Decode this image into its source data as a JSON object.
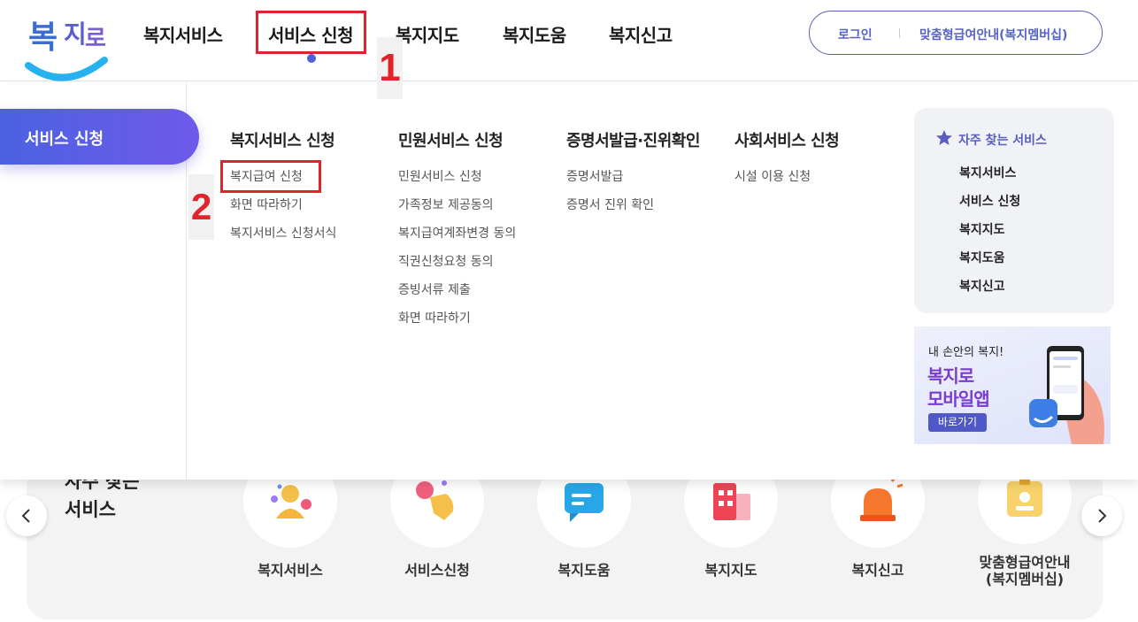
{
  "header": {
    "nav": [
      "복지서비스",
      "서비스 신청",
      "복지지도",
      "복지도움",
      "복지신고"
    ],
    "login": "로그인",
    "custom_benefit": "맞춤형급여안내(복지멤버십)"
  },
  "markers": {
    "one": "1",
    "two": "2"
  },
  "menu": {
    "active": "서비스 신청",
    "columns": [
      {
        "title": "복지서비스 신청",
        "items": [
          "복지급여 신청",
          "화면 따라하기",
          "복지서비스 신청서식"
        ]
      },
      {
        "title": "민원서비스 신청",
        "items": [
          "민원서비스 신청",
          "가족정보 제공동의",
          "복지급여계좌변경 동의",
          "직권신청요청 동의",
          "증빙서류 제출",
          "화면 따라하기"
        ]
      },
      {
        "title": "증명서발급·진위확인",
        "items": [
          "증명서발급",
          "증명서 진위 확인"
        ]
      },
      {
        "title": "사회서비스 신청",
        "items": [
          "시설 이용 신청"
        ]
      }
    ],
    "favorites": {
      "title": "자주 찾는 서비스",
      "items": [
        "복지서비스",
        "서비스 신청",
        "복지지도",
        "복지도움",
        "복지신고"
      ]
    },
    "app_banner": {
      "subtitle": "내 손안의 복지!",
      "title_1": "복지로",
      "title_2": "모바일앱",
      "button": "바로가기"
    }
  },
  "quick": {
    "title_line1": "자주 찾는",
    "title_line2": "서비스",
    "items": [
      {
        "label": "복지서비스",
        "icon": "person-icon"
      },
      {
        "label": "서비스신청",
        "icon": "hand-tap-icon"
      },
      {
        "label": "복지도움",
        "icon": "chat-bubble-icon"
      },
      {
        "label": "복지지도",
        "icon": "building-icon"
      },
      {
        "label": "복지신고",
        "icon": "siren-icon"
      },
      {
        "label_1": "맞춤형급여안내",
        "label_2": "(복지멤버십)",
        "icon": "id-badge-icon"
      }
    ]
  },
  "colors": {
    "accent": "#4e5fd9",
    "highlight": "#e0242c",
    "menu_gradient_start": "#4b62e0",
    "menu_gradient_end": "#6f59ea"
  }
}
